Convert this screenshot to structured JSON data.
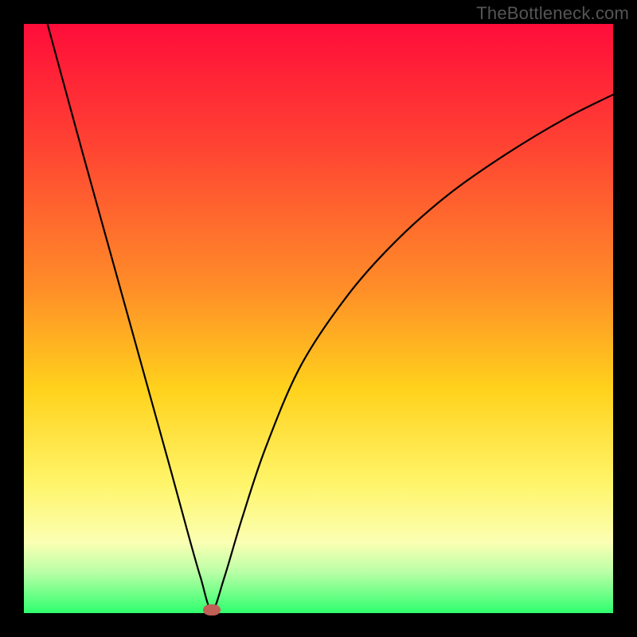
{
  "watermark": "TheBottleneck.com",
  "colors": {
    "page_bg": "#000000",
    "gradient_top": "#ff0d3a",
    "gradient_mid1": "#ff8e28",
    "gradient_mid2": "#ffd21c",
    "gradient_mid3": "#fff56a",
    "gradient_bottom": "#2eff6e",
    "curve_stroke": "#000000",
    "marker_fill": "#c06057",
    "watermark_text": "#555555"
  },
  "chart_data": {
    "type": "line",
    "title": "",
    "xlabel": "",
    "ylabel": "",
    "xlim": [
      0,
      100
    ],
    "ylim": [
      0,
      100
    ],
    "series": [
      {
        "name": "bottleneck-curve",
        "x": [
          4,
          10,
          15,
          20,
          25,
          28,
          30,
          31.9,
          34,
          37,
          41,
          47,
          55,
          63,
          72,
          82,
          92,
          100
        ],
        "values": [
          100,
          78,
          60,
          42,
          24,
          13,
          6,
          0.5,
          6,
          16,
          28,
          42,
          54,
          63,
          71,
          78,
          84,
          88
        ]
      }
    ],
    "annotations": [
      {
        "name": "min-marker",
        "x": 31.9,
        "y": 0.5,
        "shape": "ellipse"
      }
    ]
  }
}
